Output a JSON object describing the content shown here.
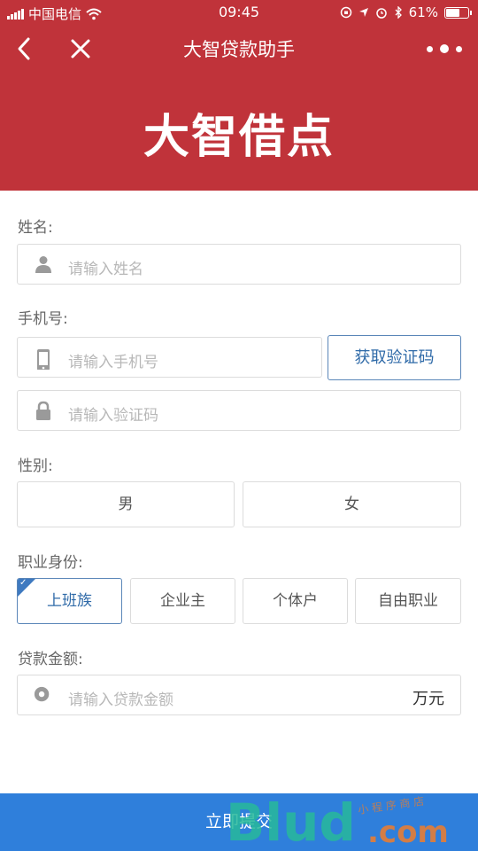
{
  "status_bar": {
    "carrier": "中国电信",
    "time": "09:45",
    "battery": "61%",
    "battery_level": 0.61
  },
  "nav": {
    "title": "大智贷款助手",
    "back_icon": "chevron-left-icon",
    "close_icon": "close-icon",
    "more_icon": "more-dots-icon"
  },
  "brand": {
    "logo_text": "大智借点"
  },
  "form": {
    "name": {
      "label": "姓名:",
      "placeholder": "请输入姓名",
      "icon": "person-icon"
    },
    "phone": {
      "label": "手机号:",
      "placeholder": "请输入手机号",
      "icon": "phone-icon",
      "get_code_label": "获取验证码"
    },
    "code": {
      "placeholder": "请输入验证码",
      "icon": "lock-icon"
    },
    "gender": {
      "label": "性别:",
      "options": [
        "男",
        "女"
      ]
    },
    "occupation": {
      "label": "职业身份:",
      "options": [
        "上班族",
        "企业主",
        "个体户",
        "自由职业"
      ],
      "selected": "上班族"
    },
    "amount": {
      "label": "贷款金额:",
      "placeholder": "请输入贷款金额",
      "unit": "万元",
      "icon": "coin-icon"
    }
  },
  "submit_label": "立即提交",
  "watermark": {
    "text": "Blud.com",
    "tagline": "小程序商店"
  },
  "colors": {
    "header_bg": "#c0333a",
    "accent_blue": "#2f6aa8",
    "submit_bg": "#2f7fdb",
    "watermark_green": "#27b89a"
  }
}
